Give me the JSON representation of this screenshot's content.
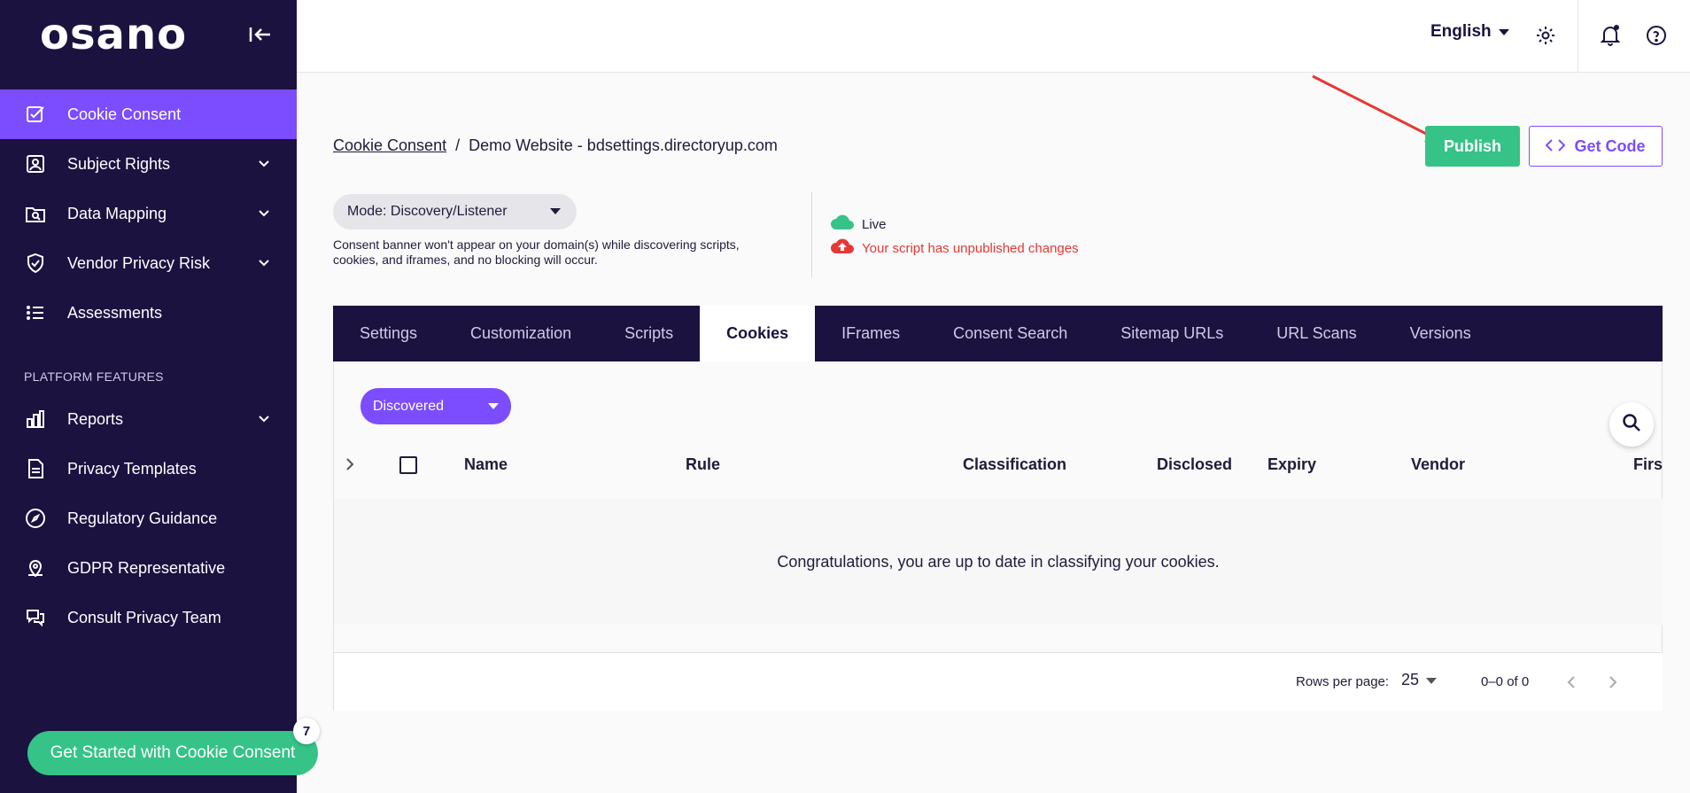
{
  "sidebar": {
    "logo": "osano",
    "items": [
      {
        "label": "Cookie Consent"
      },
      {
        "label": "Subject Rights"
      },
      {
        "label": "Data Mapping"
      },
      {
        "label": "Vendor Privacy Risk"
      },
      {
        "label": "Assessments"
      }
    ],
    "section_title": "PLATFORM FEATURES",
    "platform_items": [
      {
        "label": "Reports"
      },
      {
        "label": "Privacy Templates"
      },
      {
        "label": "Regulatory Guidance"
      },
      {
        "label": "GDPR Representative"
      },
      {
        "label": "Consult Privacy Team"
      }
    ],
    "cta_label": "Get Started with Cookie Consent",
    "cta_badge": "7"
  },
  "topbar": {
    "language": "English"
  },
  "breadcrumb": {
    "root": "Cookie Consent",
    "separator": "/",
    "current": "Demo Website - bdsettings.directoryup.com"
  },
  "actions": {
    "publish": "Publish",
    "get_code": "Get Code"
  },
  "mode": {
    "label": "Mode: Discovery/Listener",
    "note": "Consent banner won't appear on your domain(s) while discovering scripts, cookies, and iframes, and no blocking will occur."
  },
  "status": {
    "live": "Live",
    "warning": "Your script has unpublished changes"
  },
  "tabs": [
    "Settings",
    "Customization",
    "Scripts",
    "Cookies",
    "IFrames",
    "Consent Search",
    "Sitemap URLs",
    "URL Scans",
    "Versions"
  ],
  "filter": {
    "selected": "Discovered"
  },
  "table": {
    "columns": [
      "Name",
      "Rule",
      "Classification",
      "Disclosed",
      "Expiry",
      "Vendor",
      "First"
    ],
    "empty_message": "Congratulations, you are up to date in classifying your cookies.",
    "rows_per_page_label": "Rows per page:",
    "rows_per_page": "25",
    "range": "0–0 of 0"
  },
  "colors": {
    "sidebar_bg": "#1b1240",
    "accent": "#7c4dff",
    "success": "#35c388",
    "danger": "#e53935"
  }
}
